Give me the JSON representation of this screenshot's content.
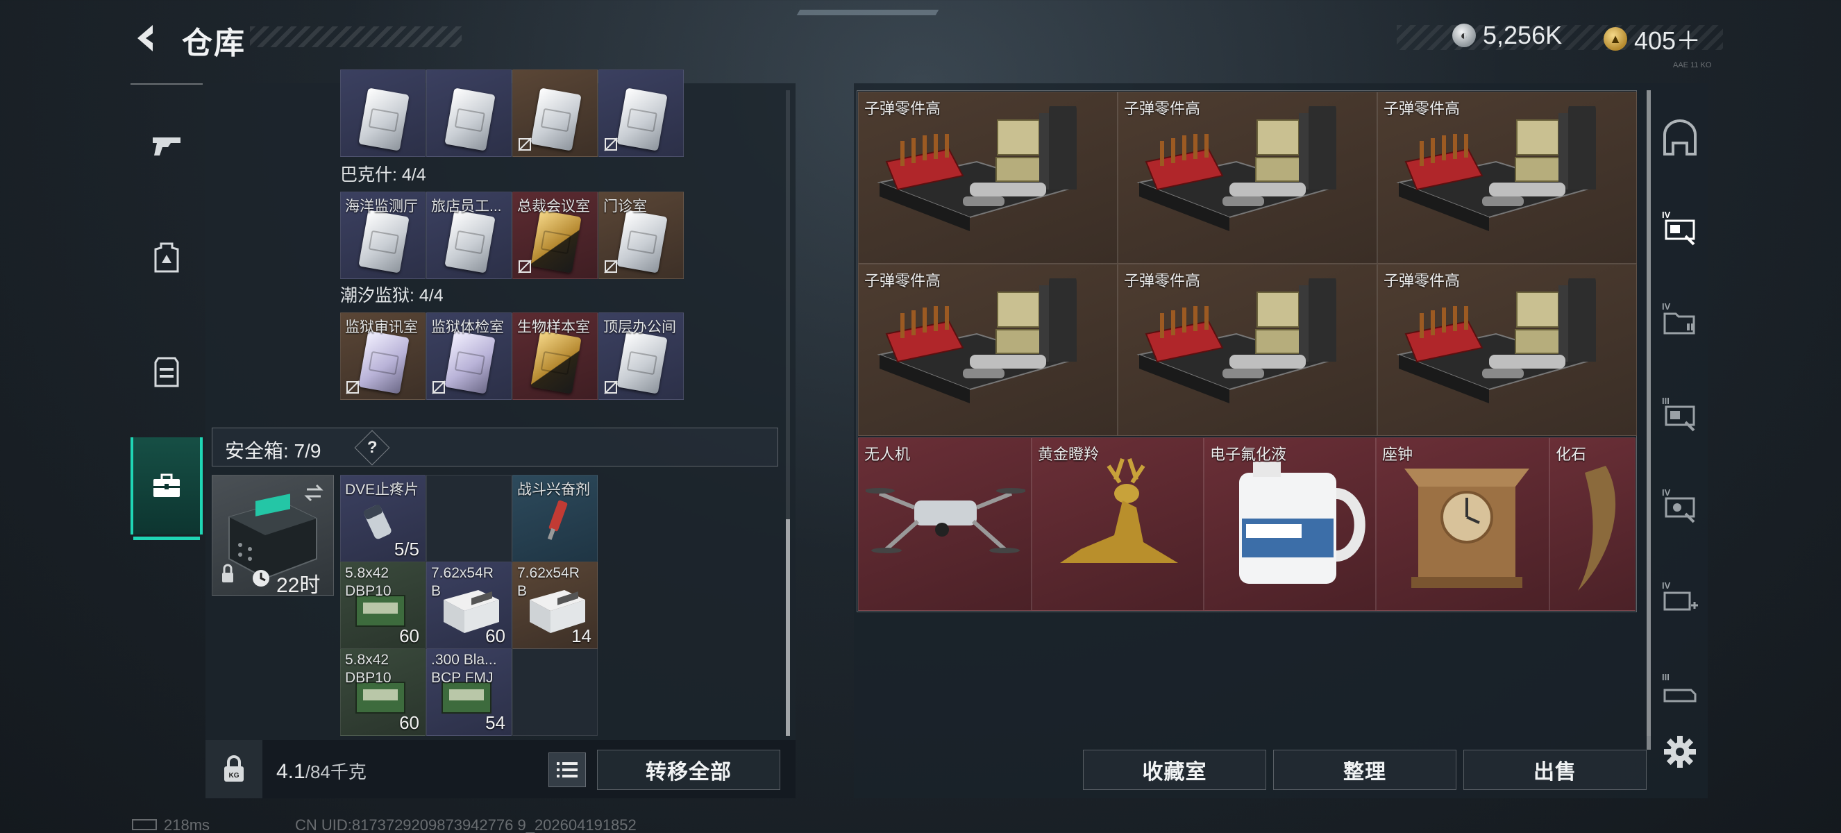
{
  "header": {
    "title": "仓库",
    "currency_silver": "5,256K",
    "currency_gold": "405＋",
    "tag": "AAE 11 KO"
  },
  "left_nav": {
    "items": [
      "weapon-icon",
      "backpack-icon",
      "vest-icon",
      "case-icon"
    ],
    "active": "case-icon"
  },
  "keys": {
    "row0": [
      {
        "label": "",
        "card": "white",
        "bg": "purple",
        "nobind": false
      },
      {
        "label": "",
        "card": "white",
        "bg": "purple",
        "nobind": false
      },
      {
        "label": "",
        "card": "white",
        "bg": "brown",
        "nobind": true
      },
      {
        "label": "",
        "card": "white",
        "bg": "purple",
        "nobind": true
      }
    ],
    "section1": "巴克什: 4/4",
    "row1": [
      {
        "label": "海洋监测厅",
        "card": "white",
        "bg": "purple",
        "nobind": false
      },
      {
        "label": "旅店员工...",
        "card": "white",
        "bg": "purple",
        "nobind": false
      },
      {
        "label": "总裁会议室",
        "card": "gold",
        "bg": "red",
        "nobind": true
      },
      {
        "label": "门诊室",
        "card": "white",
        "bg": "brown",
        "nobind": true
      }
    ],
    "section2": "潮汐监狱: 4/4",
    "row2": [
      {
        "label": "监狱审讯室",
        "card": "lavender",
        "bg": "brown",
        "nobind": true
      },
      {
        "label": "监狱体检室",
        "card": "lavender",
        "bg": "purple",
        "nobind": true
      },
      {
        "label": "生物样本室",
        "card": "gold",
        "bg": "red",
        "nobind": false
      },
      {
        "label": "顶层办公间",
        "card": "white",
        "bg": "purple",
        "nobind": true
      }
    ]
  },
  "safe": {
    "label": "安全箱: 7/9",
    "help": "?",
    "timer": "22时",
    "slots": [
      {
        "label": "DVE止疼片",
        "label2": "",
        "count": "5/5",
        "bg": "purple"
      },
      {
        "label": "",
        "label2": "",
        "count": "",
        "bg": "dark"
      },
      {
        "label": "战斗兴奋剂",
        "label2": "",
        "count": "",
        "bg": "blue"
      },
      {
        "label": "5.8x42",
        "label2": "DBP10",
        "count": "60",
        "bg": "green"
      },
      {
        "label": "7.62x54R",
        "label2": "B",
        "count": "60",
        "bg": "purple"
      },
      {
        "label": "7.62x54R",
        "label2": "B",
        "count": "14",
        "bg": "brown"
      },
      {
        "label": "5.8x42",
        "label2": "DBP10",
        "count": "60",
        "bg": "green"
      },
      {
        "label": ".300 Bla...",
        "label2": "BCP FMJ",
        "count": "54",
        "bg": "purple"
      },
      {
        "label": "",
        "label2": "",
        "count": "",
        "bg": "dark"
      }
    ]
  },
  "footer_left": {
    "weight": "4.1",
    "weight_max": "/84千克",
    "transfer_all": "转移全部"
  },
  "stash": {
    "big_items": [
      {
        "label": "子弹零件高",
        "type": "crate"
      },
      {
        "label": "子弹零件高",
        "type": "crate"
      },
      {
        "label": "子弹零件高",
        "type": "crate"
      },
      {
        "label": "子弹零件高",
        "type": "crate"
      },
      {
        "label": "子弹零件高",
        "type": "crate"
      },
      {
        "label": "子弹零件高",
        "type": "crate"
      }
    ],
    "red_items": [
      {
        "label": "无人机",
        "type": "drone"
      },
      {
        "label": "黄金瞪羚",
        "type": "gazelle"
      },
      {
        "label": "电子氟化液",
        "type": "jug"
      },
      {
        "label": "座钟",
        "type": "clock"
      },
      {
        "label": "化石",
        "type": "fossil"
      }
    ]
  },
  "footer_right": {
    "collection": "收藏室",
    "sort": "整理",
    "sell": "出售"
  },
  "status": {
    "ping": "218ms",
    "uid": "CN UID:8173729209873942776 9_202604191852"
  },
  "colors": {
    "accent": "#1fd6b5",
    "rare_purple": "#3b4060",
    "rare_gold": "#5a4636",
    "rare_red": "#5c2b31"
  }
}
